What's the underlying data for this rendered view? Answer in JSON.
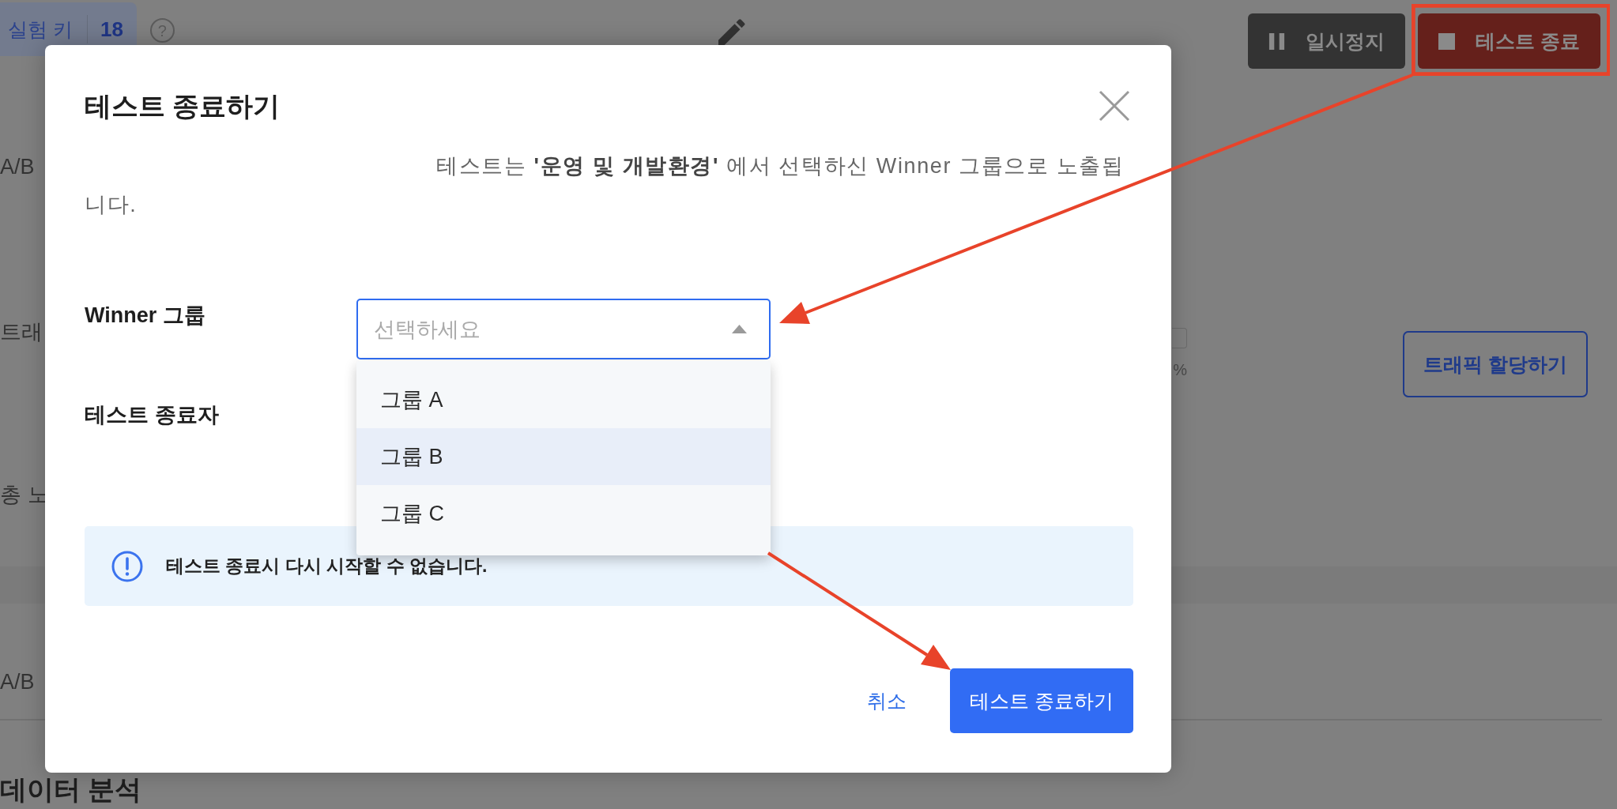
{
  "background_page": {
    "experiment_key": {
      "label": "실험 키",
      "value": "18"
    },
    "help_icon": "?",
    "toolbar_buttons": [
      {
        "label": "일시정지",
        "kind": "pause"
      },
      {
        "label": "테스트 종료",
        "kind": "stop"
      }
    ],
    "rows": [
      {
        "label": "A/B"
      },
      {
        "label": "트래",
        "unit": "%",
        "button": "트래픽 할당하기"
      },
      {
        "label": "총 노"
      }
    ],
    "section": {
      "label": "A/B",
      "heading": "데이터 분석"
    }
  },
  "dialog": {
    "title": "테스트 종료하기",
    "description": "테스트는 **'운영 및 개발환경'** 에서 선택하신 Winner 그룹으로 노출됩니다.",
    "fields": [
      {
        "label": "Winner 그룹",
        "select": {
          "placeholder": "선택하세요",
          "expanded": true,
          "options": [
            {
              "label": "그룹 A",
              "selected": false
            },
            {
              "label": "그룹 B",
              "selected": true
            },
            {
              "label": "그룹 C",
              "selected": false
            }
          ]
        }
      },
      {
        "label": "테스트 종료자"
      }
    ],
    "notice": "테스트 종료시 다시 시작할 수 없습니다.",
    "buttons": [
      {
        "label": "취소",
        "kind": "link"
      },
      {
        "label": "테스트 종료하기",
        "kind": "primary"
      }
    ]
  }
}
